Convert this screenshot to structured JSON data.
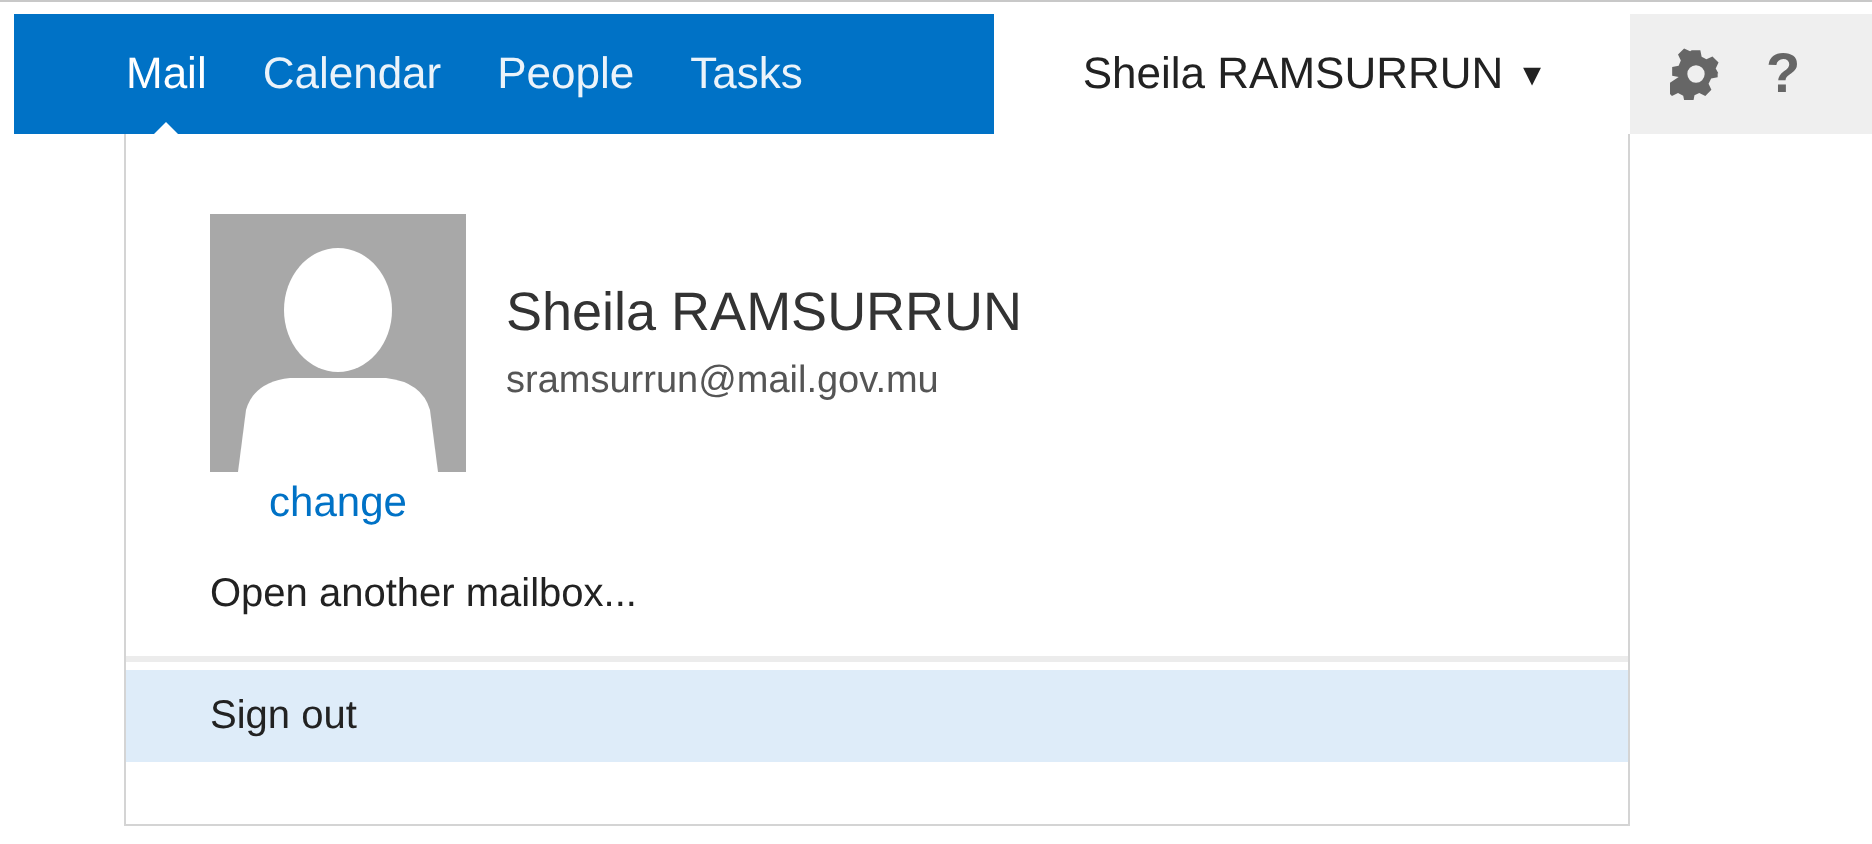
{
  "nav_tabs": [
    {
      "label": "Mail",
      "selected": true
    },
    {
      "label": "Calendar",
      "selected": false
    },
    {
      "label": "People",
      "selected": false
    },
    {
      "label": "Tasks",
      "selected": false
    }
  ],
  "user_menu": {
    "label": "Sheila RAMSURRUN",
    "expanded": true,
    "caret": "▾"
  },
  "toolbar": {
    "help": "?"
  },
  "profile": {
    "name": "Sheila RAMSURRUN",
    "email": "sramsurrun@mail.gov.mu",
    "change_link": "change"
  },
  "menu_items": [
    {
      "label": "Open another mailbox...",
      "selected": false
    },
    {
      "label": "Sign out",
      "selected": true
    }
  ]
}
